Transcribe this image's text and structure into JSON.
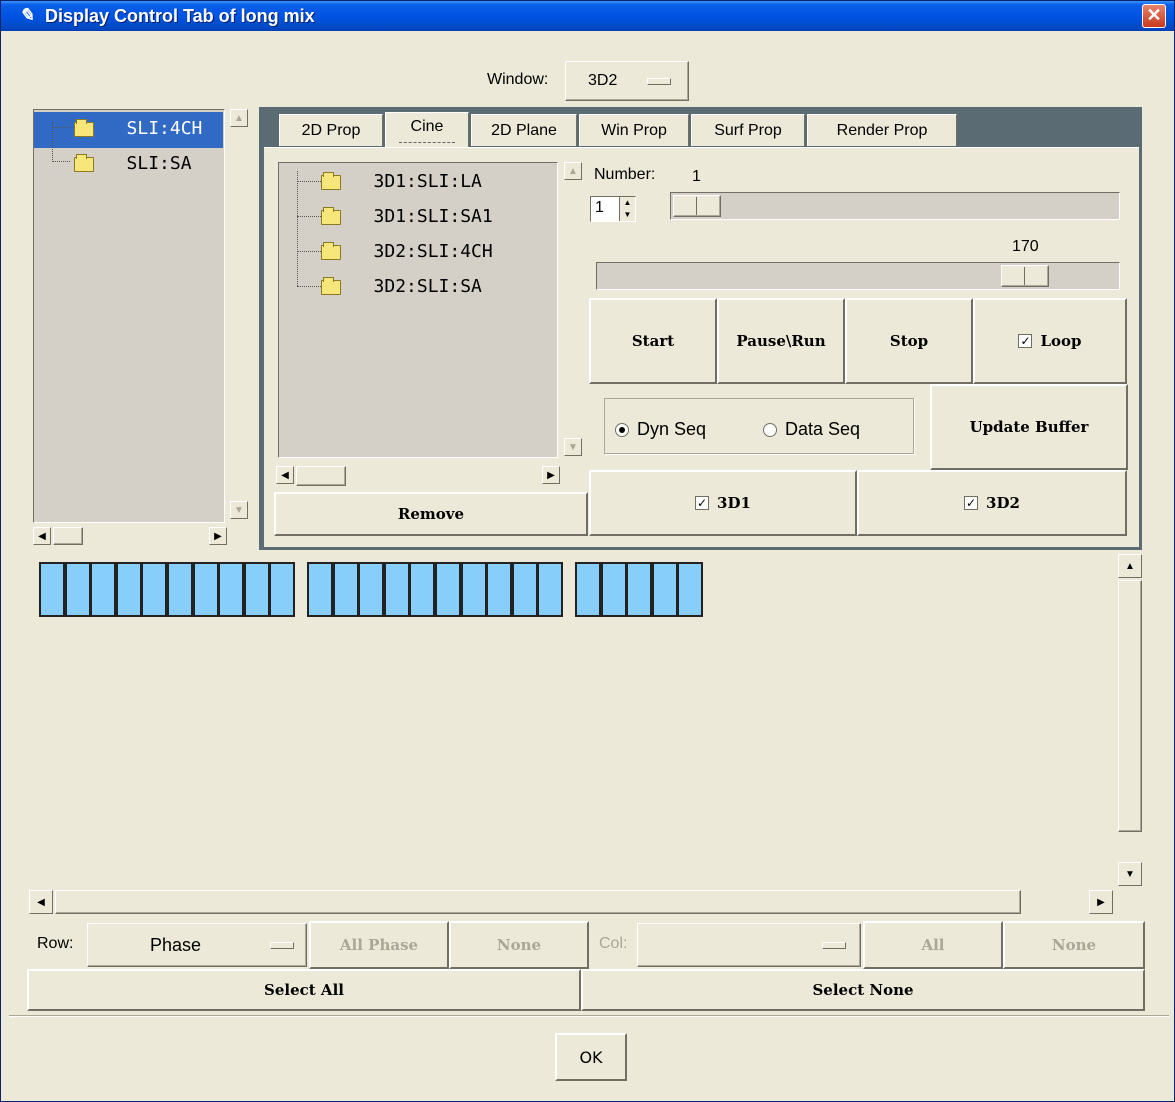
{
  "window": {
    "title": "Display Control Tab of long mix",
    "close_glyph": "✕"
  },
  "window_select": {
    "label": "Window:",
    "value": "3D2"
  },
  "left_tree": {
    "items": [
      {
        "label": "SLI:4CH",
        "selected": true
      },
      {
        "label": "SLI:SA",
        "selected": false
      }
    ]
  },
  "tabs": [
    {
      "label": "2D Prop"
    },
    {
      "label": "Cine",
      "active": true
    },
    {
      "label": "2D Plane"
    },
    {
      "label": "Win Prop"
    },
    {
      "label": "Surf Prop"
    },
    {
      "label": "Render Prop"
    }
  ],
  "cine": {
    "tree_items": [
      "3D1:SLI:LA",
      "3D1:SLI:SA1",
      "3D2:SLI:4CH",
      "3D2:SLI:SA"
    ],
    "remove_label": "Remove",
    "number_label": "Number:",
    "number_value": "1",
    "number_spin_value": "1",
    "speed_value": "170",
    "start_label": "Start",
    "pause_label": "Pause\\Run",
    "stop_label": "Stop",
    "loop_label": "Loop",
    "loop_checked": true,
    "dyn_seq_label": "Dyn Seq",
    "data_seq_label": "Data Seq",
    "update_buffer_label": "Update Buffer",
    "d3d1_label": "3D1",
    "d3d2_label": "3D2"
  },
  "grid": {
    "groups": [
      10,
      10,
      5
    ],
    "cell_color": "#87cefa"
  },
  "bottom": {
    "row_label": "Row:",
    "row_value": "Phase",
    "all_phase_label": "All Phase",
    "none_label_1": "None",
    "col_label": "Col:",
    "col_value": "",
    "all_label": "All",
    "none_label_2": "None",
    "select_all_label": "Select All",
    "select_none_label": "Select None",
    "ok_label": "OK"
  },
  "icons": {
    "check": "✓",
    "up": "▲",
    "down": "▼",
    "left": "◀",
    "right": "▶"
  },
  "colors": {
    "title_blue": "#0054e3",
    "selection_blue": "#316ac5",
    "cell_blue": "#87cefa",
    "panel_bg": "#ece9d8"
  }
}
